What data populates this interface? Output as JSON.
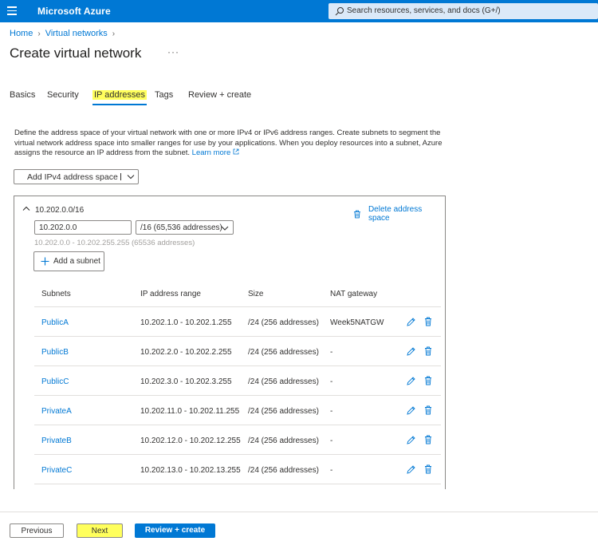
{
  "header": {
    "brand": "Microsoft Azure",
    "search_placeholder": "Search resources, services, and docs (G+/)"
  },
  "breadcrumb": {
    "items": [
      "Home",
      "Virtual networks"
    ]
  },
  "page": {
    "title": "Create virtual network",
    "more": "···"
  },
  "tabs": [
    "Basics",
    "Security",
    "IP addresses",
    "Tags",
    "Review + create"
  ],
  "active_tab": "IP addresses",
  "description": {
    "text": "Define the address space of your virtual network with one or more IPv4 or IPv6 address ranges. Create subnets to segment the virtual network address space into smaller ranges for use by your applications. When you deploy resources into a subnet, Azure assigns the resource an IP address from the subnet.",
    "link": "Learn more"
  },
  "add_space_button": "Add IPv4 address space",
  "address_space": {
    "label": "10.202.0.0/16",
    "delete_label": "Delete address space",
    "address": "10.202.0.0",
    "prefix": "/16 (65,536 addresses)",
    "range_hint": "10.202.0.0 - 10.202.255.255 (65536 addresses)",
    "add_subnet": "Add a subnet"
  },
  "subnet_table": {
    "headers": [
      "Subnets",
      "IP address range",
      "Size",
      "NAT gateway"
    ],
    "rows": [
      {
        "name": "PublicA",
        "range": "10.202.1.0 - 10.202.1.255",
        "size": "/24 (256 addresses)",
        "nat": "Week5NATGW"
      },
      {
        "name": "PublicB",
        "range": "10.202.2.0 - 10.202.2.255",
        "size": "/24 (256 addresses)",
        "nat": "-"
      },
      {
        "name": "PublicC",
        "range": "10.202.3.0 - 10.202.3.255",
        "size": "/24 (256 addresses)",
        "nat": "-"
      },
      {
        "name": "PrivateA",
        "range": "10.202.11.0 - 10.202.11.255",
        "size": "/24 (256 addresses)",
        "nat": "-"
      },
      {
        "name": "PrivateB",
        "range": "10.202.12.0 - 10.202.12.255",
        "size": "/24 (256 addresses)",
        "nat": "-"
      },
      {
        "name": "PrivateC",
        "range": "10.202.13.0 - 10.202.13.255",
        "size": "/24 (256 addresses)",
        "nat": "-"
      }
    ]
  },
  "footer": {
    "previous": "Previous",
    "next": "Next",
    "review": "Review + create"
  },
  "colors": {
    "accent": "#0078d4",
    "highlight": "#ffff5c"
  }
}
